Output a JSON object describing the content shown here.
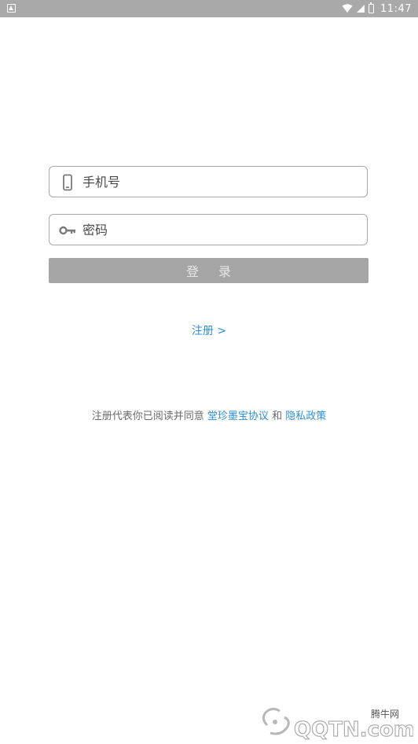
{
  "status_bar": {
    "time": "11:47",
    "background_color": "#a9a9a9"
  },
  "login_form": {
    "phone_placeholder": "手机号",
    "password_placeholder": "密码",
    "login_button_label": "登 录",
    "register_link_label": "注册 >"
  },
  "agreement": {
    "prefix": "注册代表你已阅读并同意",
    "user_agreement_link": "堂珍墨宝协议",
    "conjunction": "和",
    "privacy_link": "隐私政策"
  },
  "watermark": {
    "site_name": "腾牛网",
    "logo_text": "QQTN.com"
  },
  "colors": {
    "accent_link": "#2f8fd6",
    "button_background": "#a5a5a5",
    "border": "#a8a8a8"
  }
}
